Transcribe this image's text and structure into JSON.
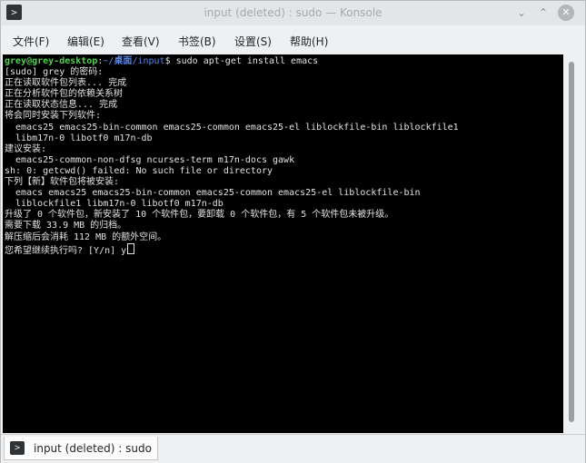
{
  "window": {
    "title": "input (deleted) : sudo — Konsole",
    "app_icon": "terminal-icon"
  },
  "menu": {
    "file": "文件(F)",
    "edit": "编辑(E)",
    "view": "查看(V)",
    "bookmarks": "书签(B)",
    "settings": "设置(S)",
    "help": "帮助(H)"
  },
  "terminal": {
    "prompt_user": "grey@grey-desktop",
    "prompt_colon": ":",
    "prompt_path_home": "~/",
    "prompt_path_desktop": "桌面",
    "prompt_path_rest": "/input",
    "prompt_symbol": "$",
    "command": " sudo apt-get install emacs",
    "lines": {
      "l2": "[sudo] grey 的密码:",
      "l3": "正在读取软件包列表... 完成",
      "l4": "正在分析软件包的依赖关系树",
      "l5": "正在读取状态信息... 完成",
      "l6": "将会同时安装下列软件:",
      "l7": "  emacs25 emacs25-bin-common emacs25-common emacs25-el liblockfile-bin liblockfile1",
      "l8": "  libm17n-0 libotf0 m17n-db",
      "l9": "建议安装:",
      "l10": "  emacs25-common-non-dfsg ncurses-term m17n-docs gawk",
      "l11": "sh: 0: getcwd() failed: No such file or directory",
      "l12": "下列【新】软件包将被安装:",
      "l13": "  emacs emacs25 emacs25-bin-common emacs25-common emacs25-el liblockfile-bin",
      "l14": "  liblockfile1 libm17n-0 libotf0 m17n-db",
      "l15": "升级了 0 个软件包，新安装了 10 个软件包，要卸载 0 个软件包，有 5 个软件包未被升级。",
      "l16": "需要下载 33.9 MB 的归档。",
      "l17": "解压缩后会消耗 112 MB 的额外空间。",
      "l18": "您希望继续执行吗? [Y/n] y"
    }
  },
  "tab": {
    "label": "input (deleted) : sudo"
  },
  "colors": {
    "terminal_bg": "#000000",
    "prompt_green": "#54d153",
    "prompt_blue": "#5b87e5",
    "text": "#e2e2e2"
  }
}
